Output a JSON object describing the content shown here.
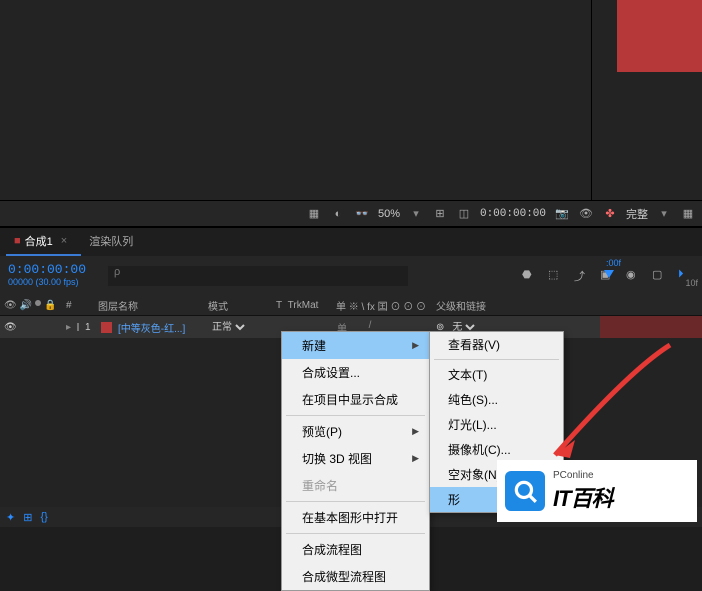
{
  "viewer_toolbar": {
    "zoom": "50%",
    "time": "0:00:00:00",
    "resolution": "完整"
  },
  "tabs": {
    "active": "合成1",
    "inactive": "渲染队列"
  },
  "timeline": {
    "timecode": "0:00:00:00",
    "fps": "00000 (30.00 fps)",
    "search_placeholder": "ρ",
    "ruler_start": ":00f",
    "ruler_10": "10f"
  },
  "columns": {
    "layer_name": "图层名称",
    "mode": "模式",
    "t": "T",
    "trkmat": "TrkMat",
    "switches": "单 ※ \\ fx 囯 ⊙ ⊙ ⊙",
    "parent": "父级和链接"
  },
  "layer": {
    "index": "1",
    "name": "[中等灰色-红...]",
    "mode": "正常",
    "switch_text": "单",
    "parent_none": "无"
  },
  "context_menu": {
    "new": "新建",
    "comp_settings": "合成设置...",
    "show_in_project": "在项目中显示合成",
    "preview": "预览(P)",
    "switch_3d": "切换 3D 视图",
    "rename": "重命名",
    "open_egp": "在基本图形中打开",
    "flowchart": "合成流程图",
    "mini_flowchart": "合成微型流程图"
  },
  "submenu": {
    "viewer": "查看器(V)",
    "text": "文本(T)",
    "solid": "纯色(S)...",
    "light": "灯光(L)...",
    "camera": "摄像机(C)...",
    "null": "空对象(N)",
    "shape": "形"
  },
  "watermark": {
    "small": "PConline",
    "big": "IT百科"
  }
}
